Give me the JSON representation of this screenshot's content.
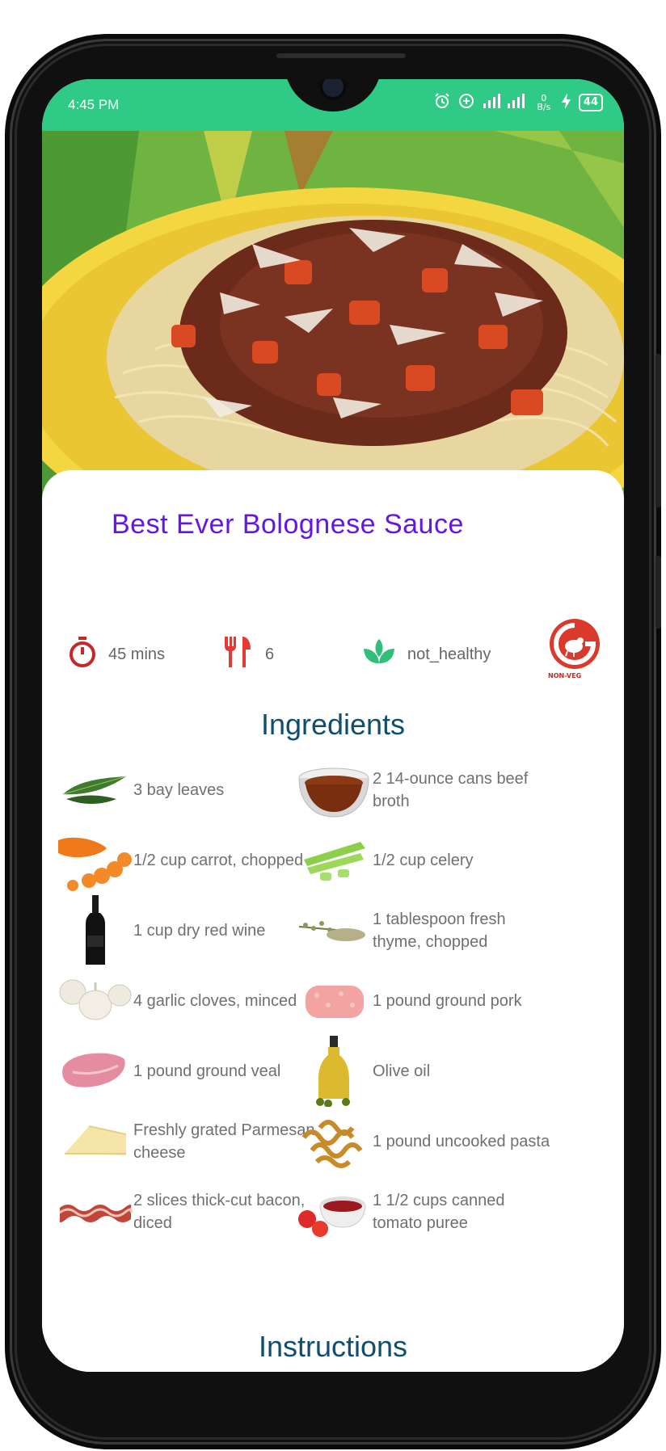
{
  "status_bar": {
    "time": "4:45 PM",
    "network": "4G",
    "data_rate": "0 B/s",
    "battery": "44"
  },
  "recipe": {
    "title": "Best Ever Bolognese Sauce",
    "time": "45 mins",
    "servings": "6",
    "health": "not_healthy",
    "diet_badge": "NON-VEG"
  },
  "ingredients_heading": "Ingredients",
  "ingredients": [
    {
      "text": "3 bay leaves",
      "icon": "bay-leaves-image"
    },
    {
      "text": "2 14-ounce cans beef broth",
      "icon": "beef-broth-image"
    },
    {
      "text": "1/2 cup carrot, chopped",
      "icon": "carrot-image"
    },
    {
      "text": "1/2 cup celery",
      "icon": "celery-image"
    },
    {
      "text": "1 cup dry red wine",
      "icon": "wine-bottle-image"
    },
    {
      "text": "1 tablespoon fresh thyme, chopped",
      "icon": "thyme-image"
    },
    {
      "text": "4 garlic cloves, minced",
      "icon": "garlic-image"
    },
    {
      "text": "1 pound ground pork",
      "icon": "ground-pork-image"
    },
    {
      "text": "1 pound ground veal",
      "icon": "veal-image"
    },
    {
      "text": "Olive oil",
      "icon": "olive-oil-image"
    },
    {
      "text": "Freshly grated Parmesan cheese",
      "icon": "parmesan-image"
    },
    {
      "text": "1 pound uncooked pasta",
      "icon": "pasta-image"
    },
    {
      "text": "2 slices thick-cut bacon, diced",
      "icon": "bacon-image"
    },
    {
      "text": "1 1/2 cups canned tomato puree",
      "icon": "tomato-puree-image"
    }
  ],
  "instructions_heading": "Instructions",
  "colors": {
    "status_bar": "#2fcb86",
    "title": "#6416e6",
    "heading": "#0f4e6e",
    "timer": "#c62828",
    "cutlery": "#e53935",
    "leaf": "#2fbf7a",
    "non_veg": "#d93a2b"
  }
}
